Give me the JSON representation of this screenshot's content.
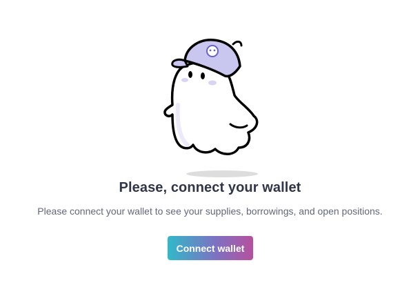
{
  "empty_state": {
    "title": "Please, connect your wallet",
    "message": "Please connect your wallet to see your supplies, borrowings, and open positions.",
    "illustration": "ghost-with-cap",
    "cap_logo": "aave-ghost-logo-icon"
  },
  "actions": {
    "connect_label": "Connect wallet"
  },
  "colors": {
    "title": "#303549",
    "message": "#62677b",
    "button_gradient_start": "#31b9c9",
    "button_gradient_end": "#b6509e",
    "cap": "#c9c6f0",
    "shadow": "#dddddd"
  }
}
